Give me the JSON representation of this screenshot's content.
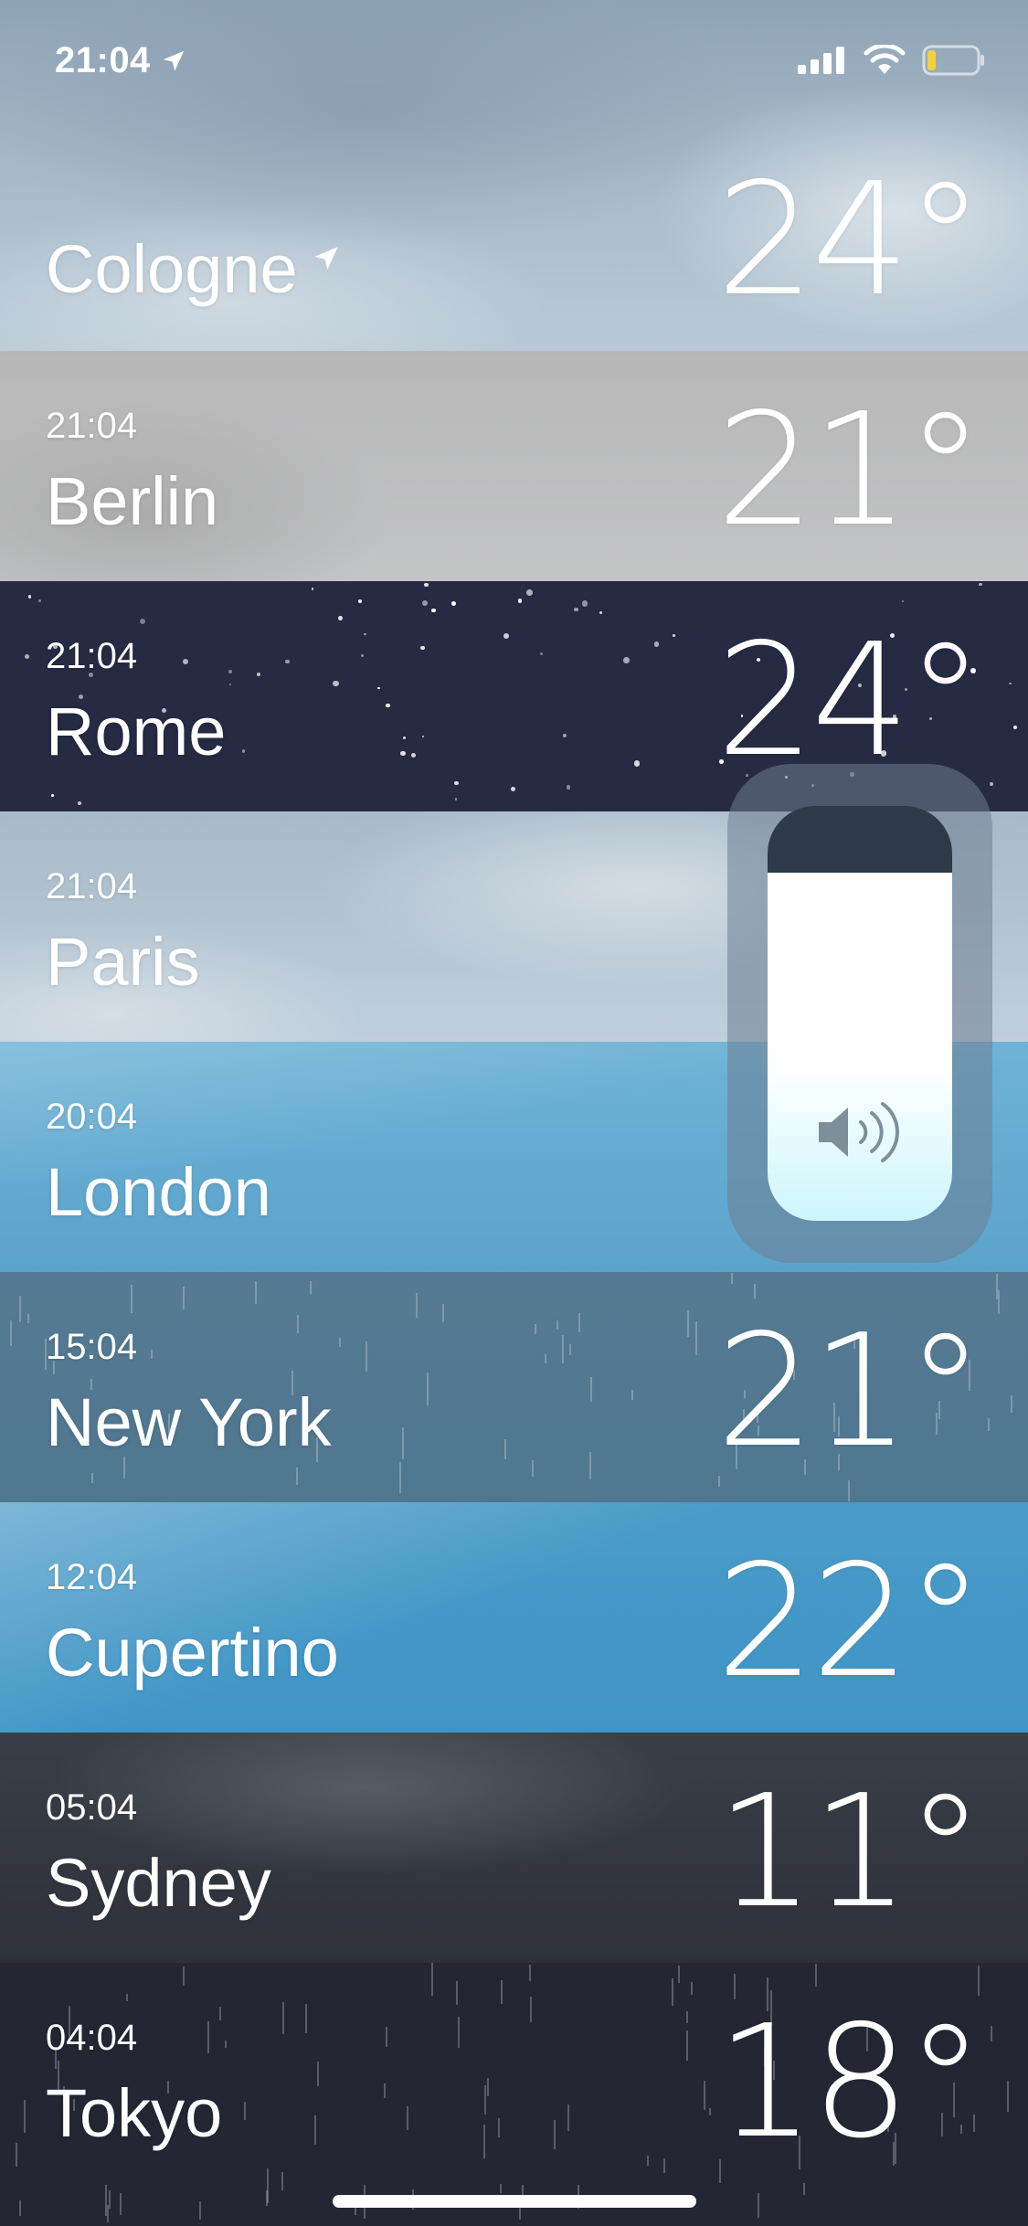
{
  "status_bar": {
    "time": "21:04",
    "icons": [
      "location-arrow-icon",
      "signal-icon",
      "wifi-icon",
      "battery-icon"
    ]
  },
  "cities": [
    {
      "key": "cologne",
      "time": "",
      "name": "Cologne",
      "temp": "24°",
      "current_location": true
    },
    {
      "key": "berlin",
      "time": "21:04",
      "name": "Berlin",
      "temp": "21°"
    },
    {
      "key": "rome",
      "time": "21:04",
      "name": "Rome",
      "temp": "24°"
    },
    {
      "key": "paris",
      "time": "21:04",
      "name": "Paris",
      "temp": ""
    },
    {
      "key": "london",
      "time": "20:04",
      "name": "London",
      "temp": ""
    },
    {
      "key": "newyork",
      "time": "15:04",
      "name": "New York",
      "temp": "21°"
    },
    {
      "key": "cupertino",
      "time": "12:04",
      "name": "Cupertino",
      "temp": "22°"
    },
    {
      "key": "sydney",
      "time": "05:04",
      "name": "Sydney",
      "temp": "11°"
    },
    {
      "key": "tokyo",
      "time": "04:04",
      "name": "Tokyo",
      "temp": "18°"
    }
  ],
  "volume_hud": {
    "level": 0.84,
    "icon": "speaker-icon"
  },
  "colors": {
    "battery_level": "#f4d03f"
  }
}
